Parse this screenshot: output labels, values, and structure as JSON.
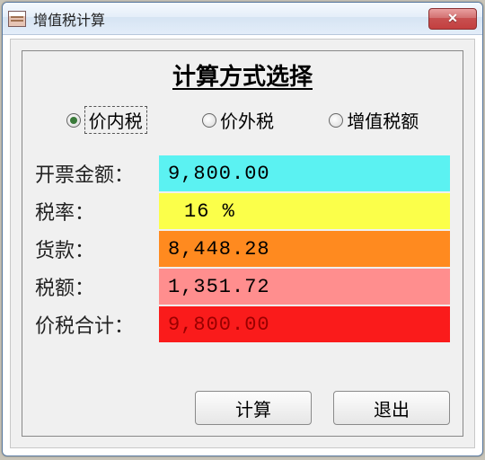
{
  "window": {
    "title": "增值税计算"
  },
  "section_title": "计算方式选择",
  "radios": {
    "opt1": "价内税",
    "opt2": "价外税",
    "opt3": "增值税额",
    "selected": 0
  },
  "labels": {
    "invoice_amount": "开票金额：",
    "tax_rate": "税率：",
    "goods_amount": "货款：",
    "tax_amount": "税额：",
    "total": "价税合计："
  },
  "values": {
    "invoice_amount": "9,800.00",
    "tax_rate": "16  %",
    "goods_amount": "8,448.28",
    "tax_amount": "1,351.72",
    "total": "9,800.00"
  },
  "buttons": {
    "calc": "计算",
    "exit": "退出"
  }
}
